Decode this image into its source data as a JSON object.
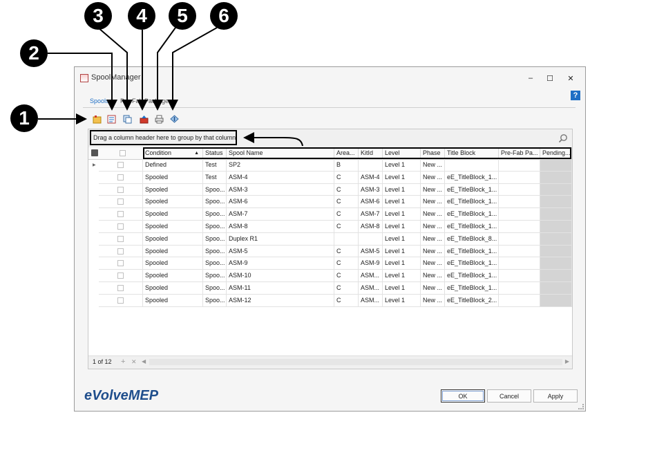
{
  "callouts": [
    "1",
    "2",
    "3",
    "4",
    "5",
    "6"
  ],
  "window": {
    "title": "SpoolManager",
    "minimize": "‒",
    "maximize": "☐",
    "close": "✕",
    "help": "?"
  },
  "tabs": [
    {
      "label": "Spools",
      "active": true
    },
    {
      "label": "Pre-Fab Packages",
      "active": false
    }
  ],
  "toolbar": {
    "icons": [
      "new-spool-icon",
      "edit-spool-icon",
      "copy-spool-icon",
      "export-icon",
      "print-icon",
      "import-icon"
    ]
  },
  "grid": {
    "group_panel_text": "Drag a column header here to group by that column",
    "columns": [
      "Condition",
      "Status",
      "Spool Name",
      "Area...",
      "KitId",
      "Level",
      "Phase",
      "Title Block",
      "Pre-Fab Pa...",
      "Pending..."
    ],
    "rows": [
      [
        "Defined",
        "Test",
        "SP2",
        "B",
        "",
        "Level 1",
        "New ...",
        "",
        "",
        ""
      ],
      [
        "Spooled",
        "Test",
        "ASM-4",
        "C",
        "ASM-4",
        "Level 1",
        "New ...",
        "eE_TitleBlock_1...",
        "",
        ""
      ],
      [
        "Spooled",
        "Spoo...",
        "ASM-3",
        "C",
        "ASM-3",
        "Level 1",
        "New ...",
        "eE_TitleBlock_1...",
        "",
        ""
      ],
      [
        "Spooled",
        "Spoo...",
        "ASM-6",
        "C",
        "ASM-6",
        "Level 1",
        "New ...",
        "eE_TitleBlock_1...",
        "",
        ""
      ],
      [
        "Spooled",
        "Spoo...",
        "ASM-7",
        "C",
        "ASM-7",
        "Level 1",
        "New ...",
        "eE_TitleBlock_1...",
        "",
        ""
      ],
      [
        "Spooled",
        "Spoo...",
        "ASM-8",
        "C",
        "ASM-8",
        "Level 1",
        "New ...",
        "eE_TitleBlock_1...",
        "",
        ""
      ],
      [
        "Spooled",
        "Spoo...",
        "Duplex R1",
        "",
        "",
        "Level 1",
        "New ...",
        "eE_TitleBlock_8...",
        "",
        ""
      ],
      [
        "Spooled",
        "Spoo...",
        "ASM-5",
        "C",
        "ASM-5",
        "Level 1",
        "New ...",
        "eE_TitleBlock_1...",
        "",
        ""
      ],
      [
        "Spooled",
        "Spoo...",
        "ASM-9",
        "C",
        "ASM-9",
        "Level 1",
        "New ...",
        "eE_TitleBlock_1...",
        "",
        ""
      ],
      [
        "Spooled",
        "Spoo...",
        "ASM-10",
        "C",
        "ASM...",
        "Level 1",
        "New ...",
        "eE_TitleBlock_1...",
        "",
        ""
      ],
      [
        "Spooled",
        "Spoo...",
        "ASM-11",
        "C",
        "ASM...",
        "Level 1",
        "New ...",
        "eE_TitleBlock_1...",
        "",
        ""
      ],
      [
        "Spooled",
        "Spoo...",
        "ASM-12",
        "C",
        "ASM...",
        "Level 1",
        "New ...",
        "eE_TitleBlock_2...",
        "",
        ""
      ]
    ],
    "pager": "1 of 12",
    "pager_add": "+",
    "pager_delete": "✕"
  },
  "footer": {
    "logo": "eVolveMEP",
    "ok": "OK",
    "cancel": "Cancel",
    "apply": "Apply"
  },
  "colors": {
    "accent": "#1f6fc5",
    "logo": "#1f4e8c",
    "pending_column": "#d4d4d4"
  }
}
